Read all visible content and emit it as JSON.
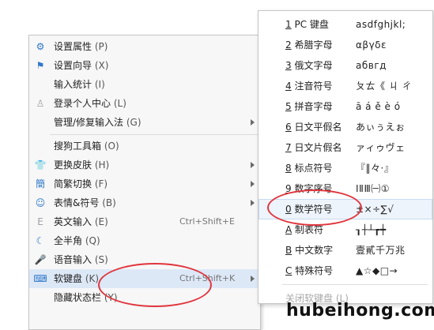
{
  "main_menu": {
    "items": [
      {
        "label": "设置属性",
        "key": "(P)",
        "icon": "gear-icon",
        "glyph": "⚙",
        "arrow": false,
        "shortcut": ""
      },
      {
        "label": "设置向导",
        "key": "(X)",
        "icon": "flag-icon",
        "glyph": "⚑",
        "arrow": false,
        "shortcut": ""
      },
      {
        "label": "输入统计",
        "key": "(I)",
        "icon": "",
        "glyph": "",
        "arrow": false,
        "shortcut": ""
      },
      {
        "label": "登录个人中心",
        "key": "(L)",
        "icon": "user-icon",
        "glyph": "♙",
        "arrow": false,
        "shortcut": ""
      },
      {
        "label": "管理/修复输入法",
        "key": "(G)",
        "icon": "",
        "glyph": "",
        "arrow": true,
        "shortcut": ""
      },
      {
        "label": "搜狗工具箱",
        "key": "(O)",
        "icon": "",
        "glyph": "",
        "arrow": false,
        "shortcut": ""
      },
      {
        "label": "更换皮肤",
        "key": "(H)",
        "icon": "shirt-icon",
        "glyph": "👕",
        "arrow": true,
        "shortcut": ""
      },
      {
        "label": "简繁切换",
        "key": "(F)",
        "icon": "traditional-chinese-icon",
        "glyph": "簡",
        "arrow": true,
        "shortcut": ""
      },
      {
        "label": "表情&符号",
        "key": "(B)",
        "icon": "smiley-icon",
        "glyph": "☺",
        "arrow": true,
        "shortcut": ""
      },
      {
        "label": "英文输入",
        "key": "(E)",
        "icon": "english-icon",
        "glyph": "E",
        "arrow": false,
        "shortcut": "Ctrl+Shift+E"
      },
      {
        "label": "全半角",
        "key": "(Q)",
        "icon": "moon-icon",
        "glyph": "☾",
        "arrow": false,
        "shortcut": ""
      },
      {
        "label": "语音输入",
        "key": "(S)",
        "icon": "microphone-icon",
        "glyph": "🎤",
        "arrow": false,
        "shortcut": ""
      },
      {
        "label": "软键盘",
        "key": "(K)",
        "icon": "keyboard-icon",
        "glyph": "⌨",
        "arrow": true,
        "shortcut": "Ctrl+Shift+K"
      },
      {
        "label": "隐藏状态栏",
        "key": "(Y)",
        "icon": "",
        "glyph": "",
        "arrow": false,
        "shortcut": ""
      }
    ]
  },
  "sub_menu": {
    "items": [
      {
        "num": "1",
        "label": "PC 键盘",
        "chars": "asdfghjkl;"
      },
      {
        "num": "2",
        "label": "希腊字母",
        "chars": "αβγδε"
      },
      {
        "num": "3",
        "label": "俄文字母",
        "chars": "абвгд"
      },
      {
        "num": "4",
        "label": "注音符号",
        "chars": "ㄆㄊ《 ㄐ ㄔ"
      },
      {
        "num": "5",
        "label": "拼音字母",
        "chars": "ā á ě è ó"
      },
      {
        "num": "6",
        "label": "日文平假名",
        "chars": "あぃぅえぉ"
      },
      {
        "num": "7",
        "label": "日文片假名",
        "chars": "ァィゥヴェ"
      },
      {
        "num": "8",
        "label": "标点符号",
        "chars": "『‖々·』"
      },
      {
        "num": "9",
        "label": "数字序号",
        "chars": "ⅠⅡⅢ㈠①"
      },
      {
        "num": "0",
        "label": "数学符号",
        "chars": "±×÷∑√"
      },
      {
        "num": "A",
        "label": "制表符",
        "chars": "┒┼┴┲┿"
      },
      {
        "num": "B",
        "label": "中文数字",
        "chars": "壹貳千万兆"
      },
      {
        "num": "C",
        "label": "特殊符号",
        "chars": "▲☆◆□→"
      }
    ],
    "close_label": "关闭软键盘",
    "close_key": "(L)"
  },
  "watermark": "hubeihong.com",
  "colors": {
    "accent": "#2f78c8",
    "highlight": "#dde8f7",
    "annotation": "#e0353d"
  }
}
